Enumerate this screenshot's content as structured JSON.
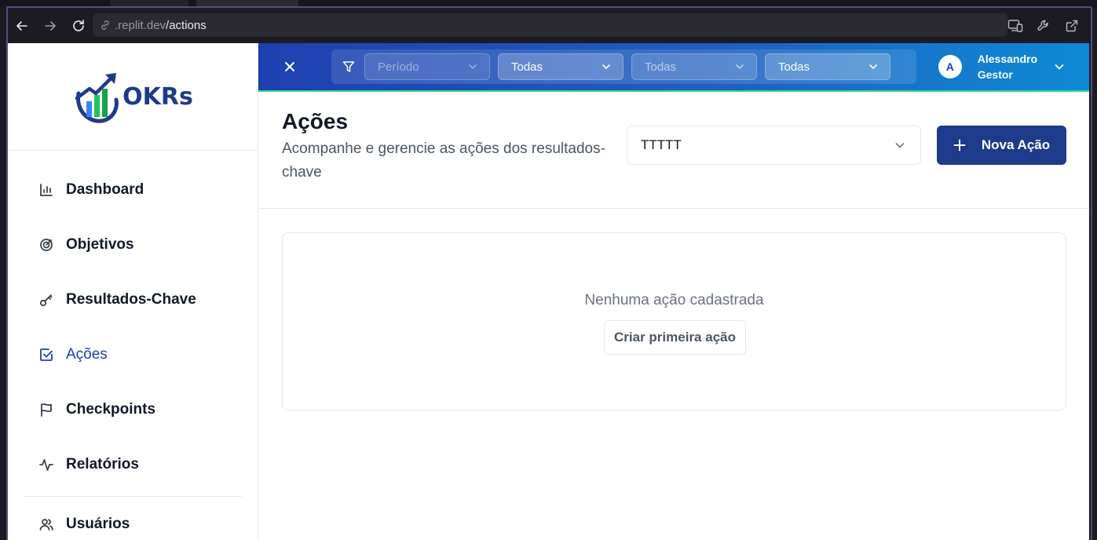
{
  "browser": {
    "url_host": ".replit.dev",
    "url_path": "/actions"
  },
  "sidebar": {
    "logo_text": "OKRs",
    "items": [
      {
        "label": "Dashboard",
        "icon": "bar-chart-icon"
      },
      {
        "label": "Objetivos",
        "icon": "target-icon"
      },
      {
        "label": "Resultados-Chave",
        "icon": "key-icon"
      },
      {
        "label": "Ações",
        "icon": "check-square-icon",
        "active": true
      },
      {
        "label": "Checkpoints",
        "icon": "flag-icon"
      },
      {
        "label": "Relatórios",
        "icon": "activity-icon"
      }
    ],
    "bottom_items": [
      {
        "label": "Usuários",
        "icon": "users-icon"
      }
    ]
  },
  "topbar": {
    "filters": [
      {
        "value": "Período",
        "state": "disabled"
      },
      {
        "value": "Todas",
        "state": "normal"
      },
      {
        "value": "Todas",
        "state": "muted"
      },
      {
        "value": "Todas",
        "state": "normal"
      }
    ],
    "user": {
      "initial": "A",
      "name": "Alessandro",
      "role": "Gestor"
    }
  },
  "header": {
    "title": "Ações",
    "subtitle": "Acompanhe e gerencie as ações dos resultados-chave",
    "kr_select_value": "TTTTT",
    "new_button_label": "Nova Ação"
  },
  "empty_state": {
    "message": "Nenhuma ação cadastrada",
    "button_label": "Criar primeira ação"
  },
  "colors": {
    "brand_dark": "#1e3a8a",
    "brand": "#1e40af",
    "accent_green": "#34d399"
  }
}
